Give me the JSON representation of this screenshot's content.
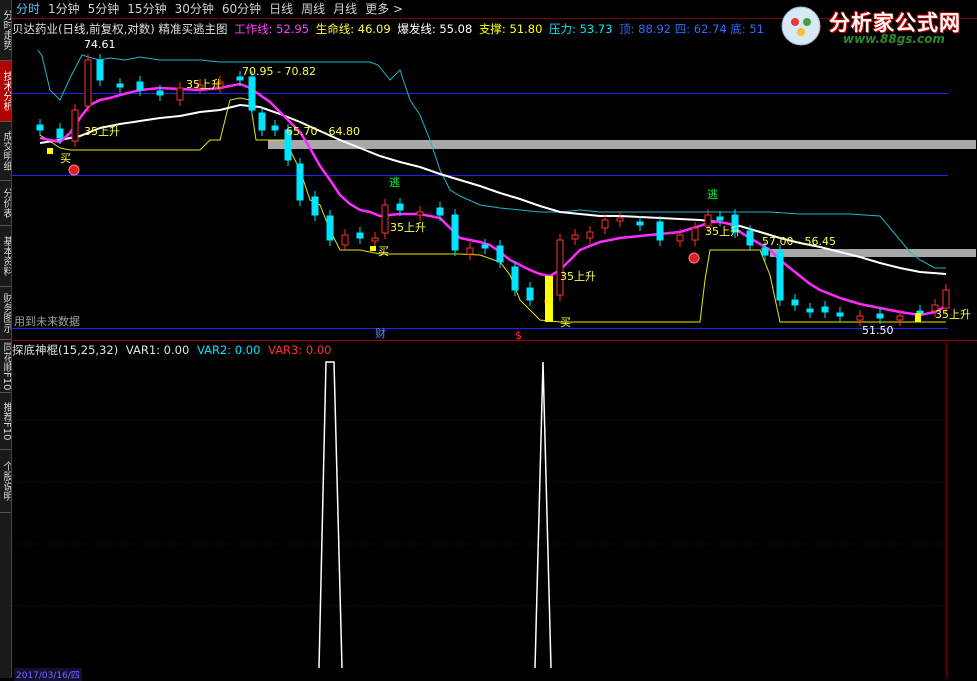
{
  "sidebar": {
    "tabs": [
      {
        "label": "分时走势",
        "active": false
      },
      {
        "label": "技术分析",
        "active": true
      },
      {
        "label": "成交明细",
        "active": false
      },
      {
        "label": "分价表",
        "active": false
      },
      {
        "label": "基本资料",
        "active": false
      },
      {
        "label": "财务图示",
        "active": false
      },
      {
        "label": "同花顺F10",
        "active": false
      },
      {
        "label": "推荐F10",
        "active": false
      },
      {
        "label": "个股说明",
        "active": false
      }
    ]
  },
  "periods": [
    {
      "label": "分时",
      "active": true
    },
    {
      "label": "1分钟",
      "active": false
    },
    {
      "label": "5分钟",
      "active": false
    },
    {
      "label": "15分钟",
      "active": false
    },
    {
      "label": "30分钟",
      "active": false
    },
    {
      "label": "60分钟",
      "active": false
    },
    {
      "label": "日线",
      "active": false
    },
    {
      "label": "周线",
      "active": false
    },
    {
      "label": "月线",
      "active": false
    },
    {
      "label": "更多 >",
      "active": false
    }
  ],
  "main_info": {
    "title": "贝达药业(日线,前复权,对数) 精准买逃主图",
    "work_line": "工作线: 52.95",
    "life_line": "生命线: 46.09",
    "burst_line": "爆发线: 55.08",
    "support": "支撑: 51.80",
    "pressure": "压力: 53.73",
    "extra": "顶: 88.92  四: 62.74  底: 51"
  },
  "sub_info": {
    "title": "探底神棍(15,25,32)",
    "var1": "VAR1: 0.00",
    "var2": "VAR2: 0.00",
    "var3": "VAR3: 0.00"
  },
  "annotations": {
    "high": "74.61",
    "range1": "70.95 - 70.82",
    "range2": "65.70 - 64.80",
    "range3": "57.00 - 56.45",
    "low": "51.50",
    "rise": "35上升",
    "buy": "买",
    "escape": "逃",
    "finance": "财",
    "dollar": "$",
    "future": "用到未来数据"
  },
  "logo": {
    "title": "分析家公式网",
    "url": "www.88gs.com"
  },
  "bottom_date": "2017/03/16/四",
  "colors": {
    "up": "#ff3030",
    "down": "#00e5ff",
    "ma_white": "#ffffff",
    "ma_magenta": "#ff00ff",
    "yellow_line": "#ffff00",
    "cyan_line": "#00bcd4",
    "gray_band": "#a0a0a0",
    "blue_hline": "#2020ff",
    "red_grid": "#5a0000"
  }
}
